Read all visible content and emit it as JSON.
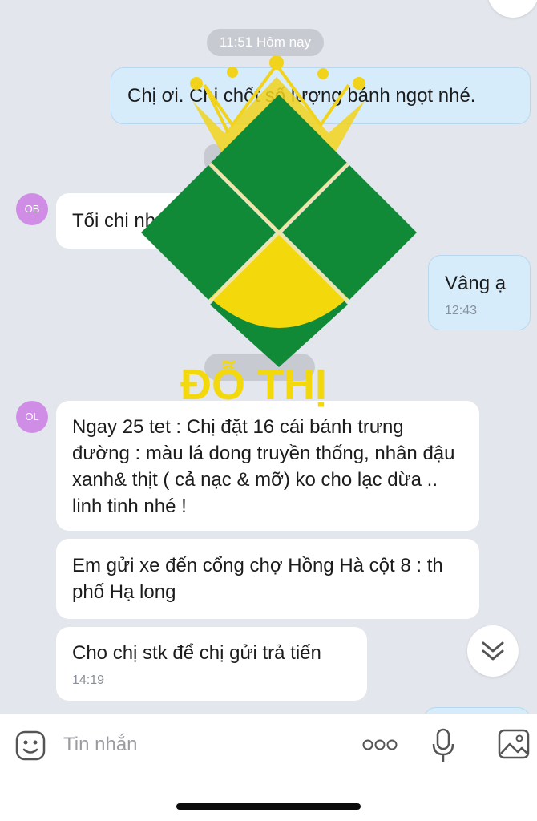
{
  "chat": {
    "date_pills": [
      "11:51 Hôm nay"
    ],
    "messages": [
      {
        "sender": "me",
        "text": "Chị ơi. Chị chốt số lượng bánh ngọt nhé."
      },
      {
        "sender": "them",
        "avatar": "OB",
        "text": "Tối chi nh"
      },
      {
        "sender": "me",
        "text": "Vâng ạ",
        "time": "12:43"
      },
      {
        "sender": "them",
        "avatar": "OL",
        "text": "Ngay 25 tet : Chị đặt 16 cái bánh trưng đường : màu lá dong truyền thống, nhân đậu xanh& thịt ( cả nạc & mỡ) ko cho lạc dừa .. linh tinh nhé !"
      },
      {
        "sender": "them",
        "text": "Em gửi xe đến cổng chợ Hồng Hà cột 8 : th phố Hạ long"
      },
      {
        "sender": "them",
        "text": "Cho chị stk để chị gửi trả tiến",
        "time": "14:19"
      }
    ]
  },
  "watermark": {
    "text": "ĐỖ THỊ",
    "colors": {
      "green": "#108a36",
      "yellow": "#f3d90b",
      "gold": "#f2d31c"
    }
  },
  "input": {
    "placeholder": "Tin nhắn"
  },
  "icons": {
    "sticker": "sticker-icon",
    "more": "more-dots-icon",
    "mic": "microphone-icon",
    "image": "image-icon",
    "scroll_down": "chevron-double-down-icon"
  },
  "colors": {
    "background": "#e3e6ec",
    "my_bubble": "#d6ecfb",
    "their_bubble": "#ffffff",
    "avatar": "#cf8de6"
  }
}
